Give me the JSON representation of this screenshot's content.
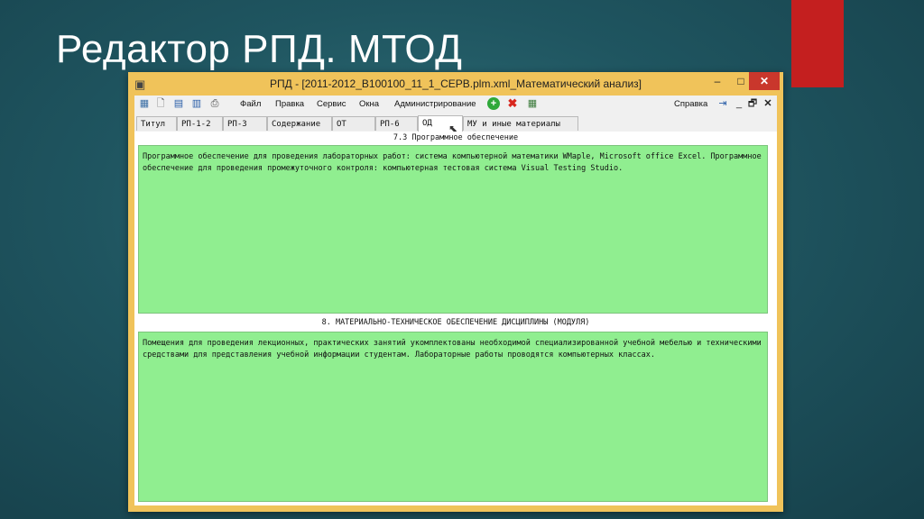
{
  "slide": {
    "title": "Редактор РПД. МТОД"
  },
  "window": {
    "title": "РПД - [2011-2012_B100100_11_1_СЕРВ.plm.xml_Математический анализ]",
    "min_glyph": "–",
    "max_glyph": "□",
    "close_glyph": "✕"
  },
  "menu": {
    "items": [
      "Файл",
      "Правка",
      "Сервис",
      "Окна",
      "Администрирование"
    ],
    "help": "Справка",
    "child_restore": "🗗",
    "child_close": "✕"
  },
  "toolbar_icons": [
    "app-icon",
    "new-doc-icon",
    "save-icon",
    "preview-icon",
    "print-icon",
    "add-icon",
    "delete-icon",
    "table-icon",
    "exit-icon",
    "minimize-child-icon"
  ],
  "tabs": [
    "Титул",
    "РП-1-2",
    "РП-3",
    "Содержание",
    "ОТ",
    "РП-6",
    "ОД",
    "МУ и иные материалы"
  ],
  "active_tab": "ОД",
  "sections": {
    "software": {
      "heading": "7.3 Программное обеспечение",
      "text": "Программное обеспечение для проведения лабораторных работ: система компьютерной математики WMaple, Microsoft office Excel. Программное обеспечение для проведения промежуточного контроля: компьютерная тестовая система Visual Testing Studio."
    },
    "material": {
      "heading": "8. МАТЕРИАЛЬНО-ТЕХНИЧЕСКОЕ ОБЕСПЕЧЕНИЕ ДИСЦИПЛИНЫ (МОДУЛЯ)",
      "text": "Помещения для проведения лекционных, практических занятий укомплектованы необходимой специализированной учебной мебелью и техническими средствами для представления учебной информации студентам. Лабораторные работы проводятся компьютерных классах."
    }
  },
  "colors": {
    "accent_red": "#c41f1f",
    "window_frame": "#f0c35a",
    "field_green": "#90ee90"
  }
}
